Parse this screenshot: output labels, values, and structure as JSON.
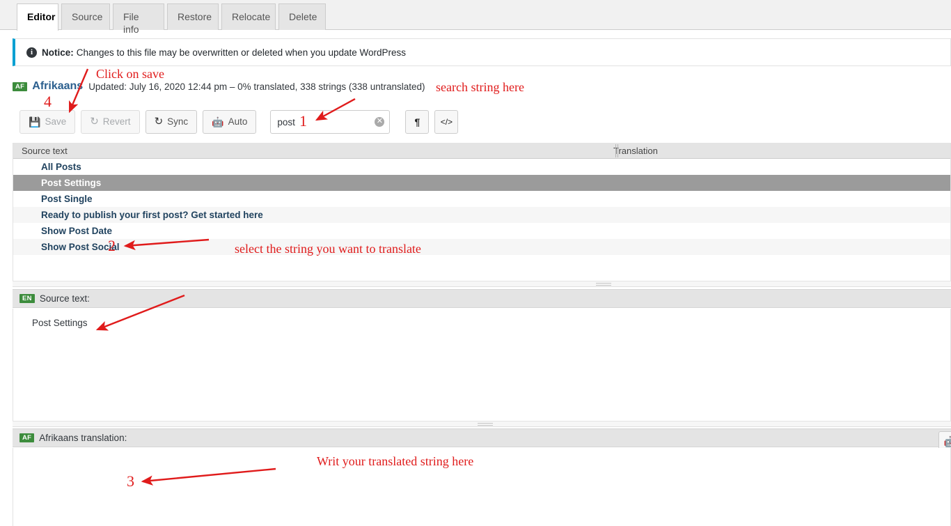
{
  "tabs": [
    {
      "label": "Editor",
      "active": true
    },
    {
      "label": "Source",
      "active": false
    },
    {
      "label": "File info",
      "active": false
    },
    {
      "label": "Restore",
      "active": false
    },
    {
      "label": "Relocate",
      "active": false
    },
    {
      "label": "Delete",
      "active": false
    }
  ],
  "notice": {
    "icon": "info-icon",
    "label": "Notice:",
    "text": "Changes to this file may be overwritten or deleted when you update WordPress",
    "accent_color": "#00a0d2"
  },
  "language_header": {
    "badge": "AF",
    "badge_color": "#3c8c3c",
    "name": "Afrikaans",
    "meta": "Updated: July 16, 2020 12:44 pm – 0% translated, 338 strings (338 untranslated)"
  },
  "toolbar": {
    "save_label": "Save",
    "save_icon": "floppy-disk-icon",
    "save_disabled": true,
    "revert_label": "Revert",
    "revert_icon": "refresh-icon",
    "revert_disabled": true,
    "sync_label": "Sync",
    "sync_icon": "sync-icon",
    "auto_label": "Auto",
    "auto_icon": "robot-icon",
    "paragraph_icon": "pilcrow-icon",
    "code_icon": "code-icon"
  },
  "search": {
    "value": "post",
    "placeholder": "Search",
    "clear_icon": "clear-circle-icon"
  },
  "table": {
    "columns": [
      "Source text",
      "Translation"
    ],
    "rows": [
      {
        "source": "All Posts",
        "translation": "",
        "selected": false
      },
      {
        "source": "Post Settings",
        "translation": "",
        "selected": true
      },
      {
        "source": "Post Single",
        "translation": "",
        "selected": false
      },
      {
        "source": "Ready to publish your first post? Get started here",
        "translation": "",
        "selected": false
      },
      {
        "source": "Show Post Date",
        "translation": "",
        "selected": false
      },
      {
        "source": "Show Post Social",
        "translation": "",
        "selected": false
      }
    ]
  },
  "source_panel": {
    "badge": "EN",
    "label": "Source text:",
    "content": "Post Settings"
  },
  "translation_panel": {
    "badge": "AF",
    "label": "Afrikaans translation:",
    "content": "",
    "robot_icon": "robot-icon"
  },
  "annotations": {
    "click_on_save": "Click on save",
    "search_string_here": "search string here",
    "select_the_string": "select the string you want to translate",
    "write_translated": "Writ your translated string here",
    "num_1": "1",
    "num_2": "2",
    "num_3": "3",
    "num_4": "4",
    "color": "#e01b1b"
  }
}
